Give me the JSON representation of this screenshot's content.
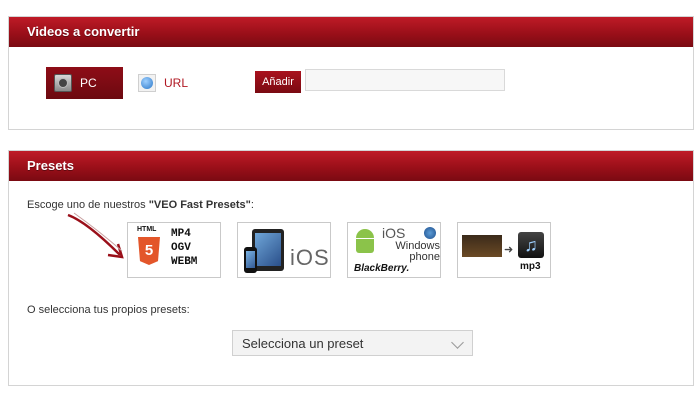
{
  "videos_panel": {
    "title": "Videos a convertir",
    "pc_label": "PC",
    "url_label": "URL",
    "add_label": "Añadir",
    "url_input_value": ""
  },
  "presets_panel": {
    "title": "Presets",
    "intro_prefix": "Escoge uno de nuestros ",
    "intro_bold": "\"VEO Fast Presets\"",
    "intro_suffix": ":",
    "presets": [
      {
        "id": "html5",
        "label": "HTML",
        "formats": [
          "MP4",
          "OGV",
          "WEBM"
        ],
        "shield": "5"
      },
      {
        "id": "ios",
        "label": "iOS"
      },
      {
        "id": "android",
        "ios_label": "iOS",
        "windows_label": "Windows phone",
        "bb_label": "BlackBerry."
      },
      {
        "id": "mp3",
        "label": "mp3"
      }
    ],
    "own_presets_label": "O selecciona tus propios presets:",
    "select_value": "Selecciona un preset"
  },
  "colors": {
    "header": "#9a0f19",
    "accent": "#b01722"
  },
  "icons": [
    "hard-drive-icon",
    "globe-icon",
    "arrow-icon",
    "chevron-down-icon"
  ]
}
